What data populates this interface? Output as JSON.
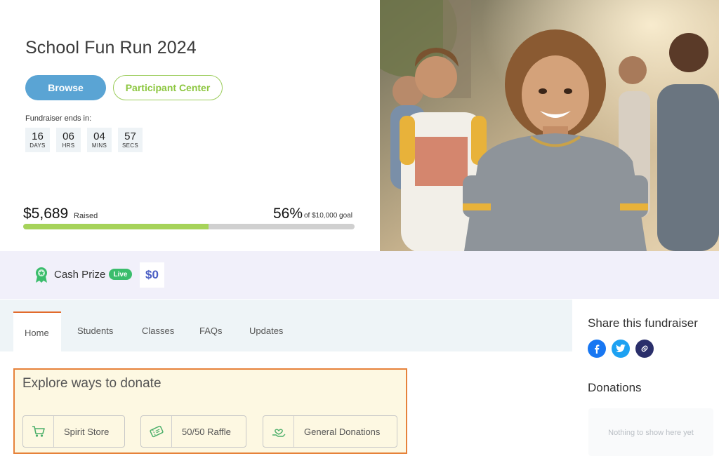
{
  "campaign": {
    "title": "School Fun Run 2024",
    "buttons": {
      "browse": "Browse",
      "participant_center": "Participant Center"
    },
    "countdown": {
      "label": "Fundraiser ends in:",
      "units": [
        {
          "value": "16",
          "unit": "DAYS"
        },
        {
          "value": "06",
          "unit": "HRS"
        },
        {
          "value": "04",
          "unit": "MINS"
        },
        {
          "value": "57",
          "unit": "SECS"
        }
      ]
    },
    "progress": {
      "raised": "$5,689",
      "raised_label": "Raised",
      "percent_text": "56%",
      "goal_text": "of $10,000 goal",
      "percent": 56,
      "fill_color": "#a6d35a"
    }
  },
  "photo": {
    "subject": "smiling teen runners outdoors"
  },
  "cash_prize": {
    "icon": "award-ribbon-icon",
    "label": "Cash Prize",
    "badge": "Live",
    "amount": "$0"
  },
  "tabs": [
    {
      "label": "Home",
      "active": true
    },
    {
      "label": "Students",
      "active": false
    },
    {
      "label": "Classes",
      "active": false
    },
    {
      "label": "FAQs",
      "active": false
    },
    {
      "label": "Updates",
      "active": false
    }
  ],
  "explore": {
    "title": "Explore ways to donate",
    "cards": [
      {
        "label": "Spirit Store",
        "icon": "shopping-cart-icon"
      },
      {
        "label": "50/50 Raffle",
        "icon": "raffle-ticket-icon"
      },
      {
        "label": "General Donations",
        "icon": "heart-hand-icon"
      }
    ]
  },
  "sidebar": {
    "share_title": "Share this fundraiser",
    "social": [
      "facebook-icon",
      "twitter-icon",
      "link-icon"
    ],
    "donations_title": "Donations",
    "donations_empty": "Nothing to show here yet"
  },
  "colors": {
    "accent_blue": "#5aa4d4",
    "accent_green": "#8cc63f",
    "tab_active_border": "#e26b2c",
    "explore_border": "#e6823a",
    "live_badge": "#3bbd6c",
    "prize_amount": "#4a5ec4"
  }
}
